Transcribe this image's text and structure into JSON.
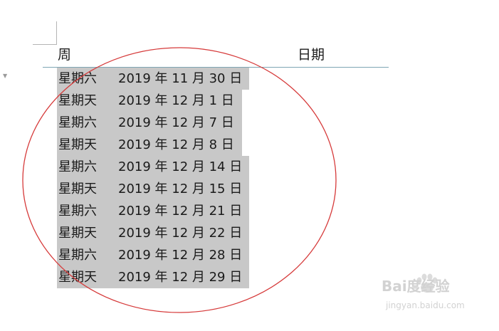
{
  "table": {
    "headers": {
      "week": "周",
      "date": "日期"
    },
    "rows": [
      {
        "week": "星期六",
        "date": "2019 年 11 月 30 日"
      },
      {
        "week": "星期天",
        "date": "2019 年 12 月 1 日"
      },
      {
        "week": "星期六",
        "date": "2019 年 12 月 7 日"
      },
      {
        "week": "星期天",
        "date": "2019 年 12 月 8 日"
      },
      {
        "week": "星期六",
        "date": "2019 年 12 月 14 日"
      },
      {
        "week": "星期天",
        "date": "2019 年 12 月 15 日"
      },
      {
        "week": "星期六",
        "date": "2019 年 12 月 21 日"
      },
      {
        "week": "星期天",
        "date": "2019 年 12 月 22 日"
      },
      {
        "week": "星期六",
        "date": "2019 年 12 月 28 日"
      },
      {
        "week": "星期天",
        "date": "2019 年 12 月 29 日"
      }
    ]
  },
  "colors": {
    "selection_highlight": "#c8c8c8",
    "annotation_circle": "#d63a3a",
    "header_rule": "#7fa6b4"
  },
  "watermark": {
    "brand": "Bai度经验",
    "url": "jingyan.baidu.com"
  }
}
